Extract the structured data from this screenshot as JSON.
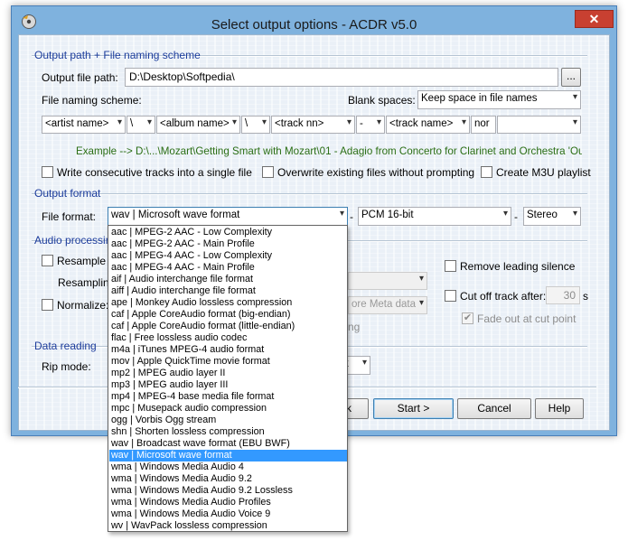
{
  "window": {
    "title": "Select output options - ACDR v5.0",
    "close_glyph": "✕"
  },
  "output_path_group": {
    "legend": "Output path + File naming scheme",
    "path_label": "Output file path:",
    "path_value": "D:\\Desktop\\Softpedia\\",
    "browse_label": "...",
    "naming_label": "File naming scheme:",
    "blank_spaces_label": "Blank spaces:",
    "blank_spaces_value": "Keep space in file names",
    "scheme": [
      "<artist name>",
      "\\",
      "<album name>",
      "\\",
      "<track nn>",
      "-",
      "<track name>",
      "nor",
      ""
    ],
    "example": "Example -->  D:\\...\\Mozart\\Getting Smart with Mozart\\01 - Adagio from Concerto for Clarinet and Orchestra 'Out Of",
    "write_consecutive_label": "Write consecutive tracks into a single file",
    "overwrite_label": "Overwrite existing files without prompting",
    "m3u_label": "Create M3U playlist"
  },
  "output_format_group": {
    "legend": "Output format",
    "file_format_label": "File format:",
    "file_format_value": "wav | Microsoft wave format",
    "codec_value": "PCM 16-bit",
    "channels_value": "Stereo",
    "sep1": "-",
    "sep2": "-"
  },
  "audio_processing_group": {
    "legend": "Audio processing",
    "resample_label": "Resample al",
    "resampling_label": "Resampling",
    "normalize_label": "Normalize:",
    "meta_partial": "ore Meta data",
    "ng_partial": "ng",
    "remove_silence_label": "Remove leading silence",
    "cut_off_label": "Cut off track after:",
    "cut_off_value": "30",
    "cut_off_unit": "s",
    "fade_label": "Fade out at cut point"
  },
  "data_reading_group": {
    "legend": "Data reading",
    "rip_mode_label": "Rip mode:",
    "rip_partial": "k"
  },
  "buttons": {
    "back_partial": "ck",
    "start": "Start >",
    "cancel": "Cancel",
    "help": "Help"
  },
  "format_options": [
    "aac | MPEG-2 AAC - Low Complexity",
    "aac | MPEG-2 AAC - Main Profile",
    "aac | MPEG-4 AAC - Low Complexity",
    "aac | MPEG-4 AAC - Main Profile",
    "aif | Audio interchange file format",
    "aiff | Audio interchange file format",
    "ape | Monkey Audio lossless compression",
    "caf | Apple CoreAudio format (big-endian)",
    "caf | Apple CoreAudio format (little-endian)",
    "flac | Free lossless audio codec",
    "m4a | iTunes MPEG-4 audio format",
    "mov | Apple QuickTime movie format",
    "mp2 | MPEG audio layer II",
    "mp3 | MPEG audio layer III",
    "mp4 | MPEG-4 base media file format",
    "mpc | Musepack audio compression",
    "ogg | Vorbis Ogg stream",
    "shn | Shorten lossless compression",
    "wav | Broadcast wave format (EBU BWF)",
    "wav | Microsoft wave format",
    "wma | Windows Media Audio 4",
    "wma | Windows Media Audio 9.2",
    "wma | Windows Media Audio 9.2 Lossless",
    "wma | Windows Media Audio Profiles",
    "wma | Windows Media Audio Voice 9",
    "wv | WavPack lossless compression"
  ],
  "selected_option_index": 19,
  "colors": {
    "group_legend": "#1c3c9c",
    "example_text": "#2a6e14",
    "selection": "#3399ff",
    "close_button": "#c84031",
    "window_frame": "#7fb2de"
  },
  "icons": {
    "dropdown_arrow": "▾",
    "check": "✔"
  }
}
